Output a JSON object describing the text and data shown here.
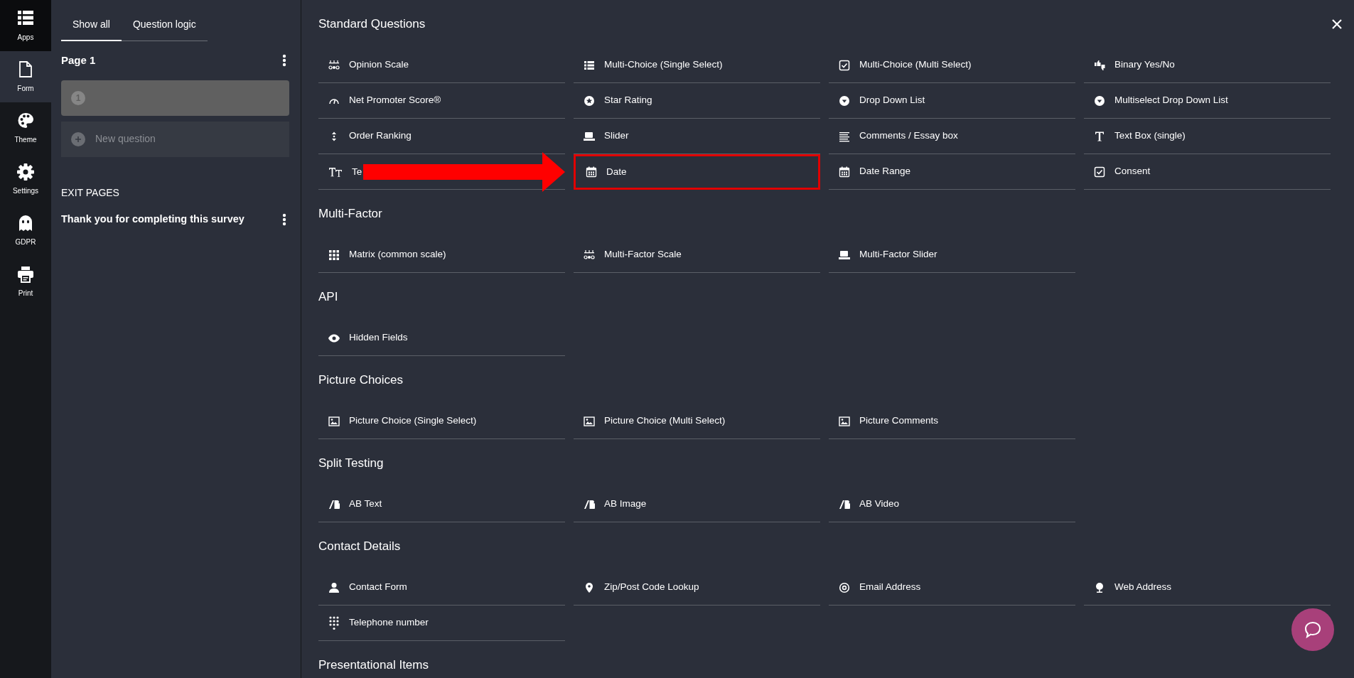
{
  "rail": [
    {
      "label": "Apps",
      "selected": false
    },
    {
      "label": "Form",
      "selected": true
    },
    {
      "label": "Theme",
      "selected": false
    },
    {
      "label": "Settings",
      "selected": false
    },
    {
      "label": "GDPR",
      "selected": false
    },
    {
      "label": "Print",
      "selected": false
    }
  ],
  "tabs": [
    {
      "label": "Show all",
      "selected": true
    },
    {
      "label": "Question logic",
      "selected": false
    }
  ],
  "pages": [
    {
      "title": "Page 1",
      "questions": [
        {
          "number": "1"
        }
      ],
      "new_question": "New question"
    }
  ],
  "exit_pages": {
    "heading": "EXIT PAGES",
    "items": [
      {
        "title": "Thank you for completing this survey"
      }
    ]
  },
  "sections": [
    {
      "title": "Standard Questions",
      "items": [
        {
          "label": "Opinion Scale",
          "highlighted": false
        },
        {
          "label": "Multi-Choice (Single Select)",
          "highlighted": false
        },
        {
          "label": "Multi-Choice (Multi Select)",
          "highlighted": false
        },
        {
          "label": "Binary Yes/No",
          "highlighted": false
        },
        {
          "label": "Net Promoter Score®",
          "highlighted": false
        },
        {
          "label": "Star Rating",
          "highlighted": false
        },
        {
          "label": "Drop Down List",
          "highlighted": false
        },
        {
          "label": "Multiselect Drop Down List",
          "highlighted": false
        },
        {
          "label": "Order Ranking",
          "highlighted": false
        },
        {
          "label": "Slider",
          "highlighted": false
        },
        {
          "label": "Comments / Essay box",
          "highlighted": false
        },
        {
          "label": "Text Box (single)",
          "highlighted": false
        },
        {
          "label": "Te",
          "highlighted": false
        },
        {
          "label": "Date",
          "highlighted": true
        },
        {
          "label": "Date Range",
          "highlighted": false
        },
        {
          "label": "Consent",
          "highlighted": false
        }
      ]
    },
    {
      "title": "Multi-Factor",
      "items": [
        {
          "label": "Matrix (common scale)",
          "highlighted": false
        },
        {
          "label": "Multi-Factor Scale",
          "highlighted": false
        },
        {
          "label": "Multi-Factor Slider",
          "highlighted": false
        }
      ]
    },
    {
      "title": "API",
      "items": [
        {
          "label": "Hidden Fields",
          "highlighted": false
        }
      ]
    },
    {
      "title": "Picture Choices",
      "items": [
        {
          "label": "Picture Choice (Single Select)",
          "highlighted": false
        },
        {
          "label": "Picture Choice (Multi Select)",
          "highlighted": false
        },
        {
          "label": "Picture Comments",
          "highlighted": false
        }
      ]
    },
    {
      "title": "Split Testing",
      "items": [
        {
          "label": "AB Text",
          "highlighted": false
        },
        {
          "label": "AB Image",
          "highlighted": false
        },
        {
          "label": "AB Video",
          "highlighted": false
        }
      ]
    },
    {
      "title": "Contact Details",
      "items": [
        {
          "label": "Contact Form",
          "highlighted": false
        },
        {
          "label": "Zip/Post Code Lookup",
          "highlighted": false
        },
        {
          "label": "Email Address",
          "highlighted": false
        },
        {
          "label": "Web Address",
          "highlighted": false
        },
        {
          "label": "Telephone number",
          "highlighted": false
        }
      ]
    },
    {
      "title": "Presentational Items"
    }
  ]
}
